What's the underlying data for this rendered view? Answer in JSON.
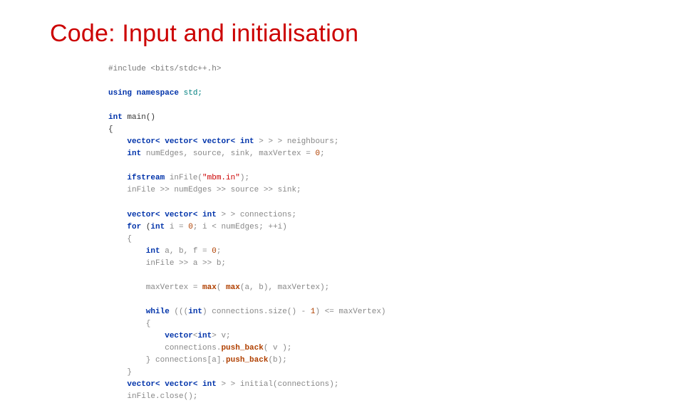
{
  "title": "Code: Input and initialisation",
  "code": {
    "l01a": "#include",
    "l01b": " <bits/stdc++.h>",
    "l03a": "using namespace",
    "l03b": " std;",
    "l05a": "int",
    "l05b": " main()",
    "l06": "{",
    "l07a": "    vector<",
    "l07b": " vector<",
    "l07c": " vector<",
    "l07d": " int",
    "l07e": " > > > neighbours;",
    "l08a": "    int",
    "l08b": " numEdges, source, sink, maxVertex = ",
    "l08c": "0",
    "l08d": ";",
    "l10a": "    ifstream",
    "l10b": " inFile(",
    "l10c": "\"mbm.in\"",
    "l10d": ");",
    "l11": "    inFile >> numEdges >> source >> sink;",
    "l13a": "    vector<",
    "l13b": " vector<",
    "l13c": " int",
    "l13d": " > > connections;",
    "l14a": "    for",
    "l14b": " (",
    "l14c": "int",
    "l14d": " i = ",
    "l14e": "0",
    "l14f": "; i < numEdges; ++i)",
    "l15": "    {",
    "l16a": "        int",
    "l16b": " a, b, f = ",
    "l16c": "0",
    "l16d": ";",
    "l17": "        inFile >> a >> b;",
    "l19a": "        maxVertex = ",
    "l19b": "max",
    "l19c": "( ",
    "l19d": "max",
    "l19e": "(a, b), maxVertex);",
    "l21a": "        while",
    "l21b": " (((",
    "l21c": "int",
    "l21d": ") connections.",
    "l21e": "size",
    "l21f": "() - ",
    "l21g": "1",
    "l21h": ") <= maxVertex)",
    "l22": "        {",
    "l23a": "            vector",
    "l23b": "<",
    "l23c": "int",
    "l23d": "> v;",
    "l24a": "            connections.",
    "l24b": "push_back",
    "l24c": "( v );",
    "l25a": "        } connections[a].",
    "l25b": "push_back",
    "l25c": "(b);",
    "l26": "    }",
    "l27a": "    vector<",
    "l27b": " vector<",
    "l27c": " int",
    "l27d": " > > initial(connections);",
    "l28": "    inFile.close();"
  }
}
